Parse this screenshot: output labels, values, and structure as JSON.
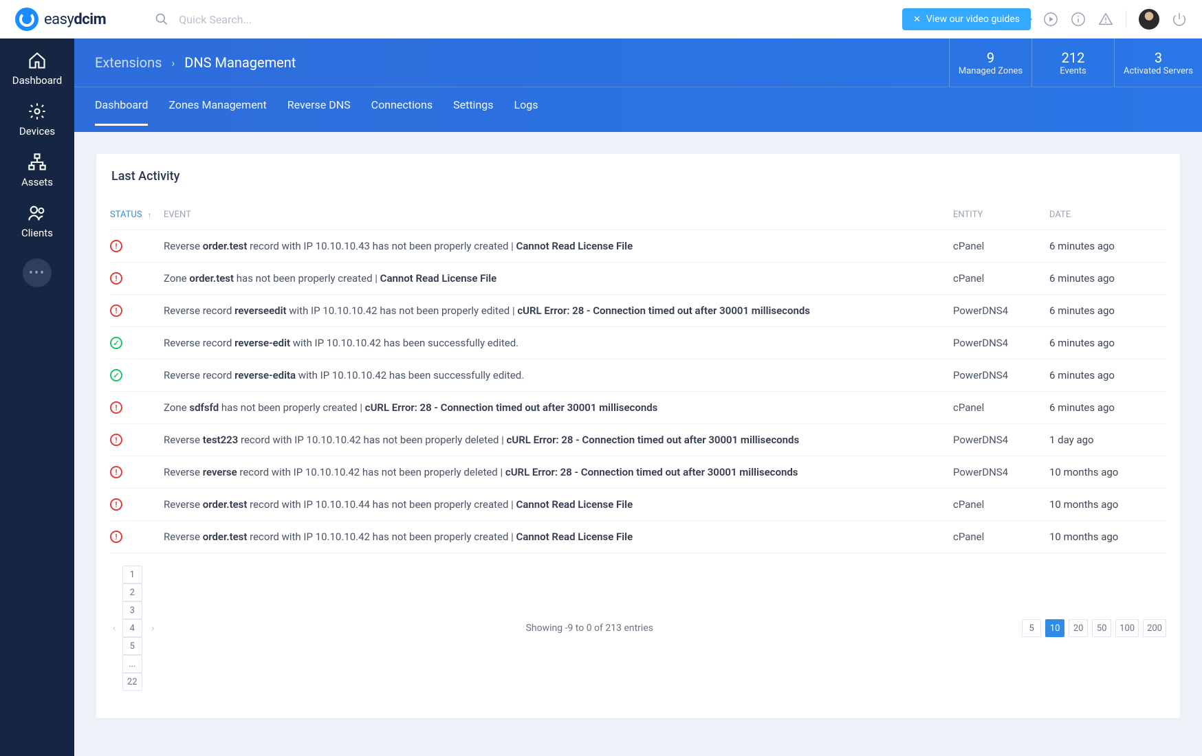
{
  "topbar": {
    "logo_prefix": "easy",
    "logo_bold": "dcim",
    "search_placeholder": "Quick Search...",
    "video_guides_label": "View our video guides"
  },
  "sidebar": {
    "items": [
      {
        "label": "Dashboard"
      },
      {
        "label": "Devices"
      },
      {
        "label": "Assets"
      },
      {
        "label": "Clients"
      }
    ]
  },
  "header": {
    "crumb1": "Extensions",
    "crumb2": "DNS Management",
    "stats": [
      {
        "num": "9",
        "label": "Managed Zones"
      },
      {
        "num": "212",
        "label": "Events"
      },
      {
        "num": "3",
        "label": "Activated Servers"
      }
    ],
    "tabs": [
      "Dashboard",
      "Zones Management",
      "Reverse DNS",
      "Connections",
      "Settings",
      "Logs"
    ],
    "active_tab": 0
  },
  "card": {
    "title": "Last Activity",
    "columns": {
      "status": "STATUS",
      "event": "EVENT",
      "entity": "ENTITY",
      "date": "DATE"
    },
    "rows": [
      {
        "status": "err",
        "pre": "Reverse ",
        "bold": "order.test",
        "post": " record with IP 10.10.10.43 has not been properly created | ",
        "tail_bold": "Cannot Read License File",
        "entity": "cPanel",
        "date": "6 minutes ago"
      },
      {
        "status": "err",
        "pre": "Zone ",
        "bold": "order.test",
        "post": " has not been properly created | ",
        "tail_bold": "Cannot Read License File",
        "entity": "cPanel",
        "date": "6 minutes ago"
      },
      {
        "status": "err",
        "pre": "Reverse record ",
        "bold": "reverseedit",
        "post": " with IP 10.10.10.42 has not been properly edited | ",
        "tail_bold": "cURL Error: 28 - Connection timed out after 30001 milliseconds",
        "entity": "PowerDNS4",
        "date": "6 minutes ago"
      },
      {
        "status": "ok",
        "pre": "Reverse record ",
        "bold": "reverse-edit",
        "post": " with IP 10.10.10.42 has been successfully edited.",
        "tail_bold": "",
        "entity": "PowerDNS4",
        "date": "6 minutes ago"
      },
      {
        "status": "ok",
        "pre": "Reverse record ",
        "bold": "reverse-edita",
        "post": " with IP 10.10.10.42 has been successfully edited.",
        "tail_bold": "",
        "entity": "PowerDNS4",
        "date": "6 minutes ago"
      },
      {
        "status": "err",
        "pre": "Zone ",
        "bold": "sdfsfd",
        "post": " has not been properly created | ",
        "tail_bold": "cURL Error: 28 - Connection timed out after 30001 milliseconds",
        "entity": "cPanel",
        "date": "6 minutes ago"
      },
      {
        "status": "err",
        "pre": "Reverse ",
        "bold": "test223",
        "post": " record with IP 10.10.10.42 has not been properly deleted | ",
        "tail_bold": "cURL Error: 28 - Connection timed out after 30001 milliseconds",
        "entity": "PowerDNS4",
        "date": "1 day ago"
      },
      {
        "status": "err",
        "pre": "Reverse ",
        "bold": "reverse",
        "post": " record with IP 10.10.10.42 has not been properly deleted | ",
        "tail_bold": "cURL Error: 28 - Connection timed out after 30001 milliseconds",
        "entity": "PowerDNS4",
        "date": "10 months ago"
      },
      {
        "status": "err",
        "pre": "Reverse ",
        "bold": "order.test",
        "post": " record with IP 10.10.10.44 has not been properly created | ",
        "tail_bold": "Cannot Read License File",
        "entity": "cPanel",
        "date": "10 months ago"
      },
      {
        "status": "err",
        "pre": "Reverse ",
        "bold": "order.test",
        "post": " record with IP 10.10.10.42 has not been properly created | ",
        "tail_bold": "Cannot Read License File",
        "entity": "cPanel",
        "date": "10 months ago"
      }
    ]
  },
  "pager": {
    "pages": [
      "1",
      "2",
      "3",
      "4",
      "5",
      "...",
      "22"
    ],
    "showing": "Showing -9 to 0 of 213 entries",
    "sizes": [
      "5",
      "10",
      "20",
      "50",
      "100",
      "200"
    ],
    "active_size": "10"
  }
}
